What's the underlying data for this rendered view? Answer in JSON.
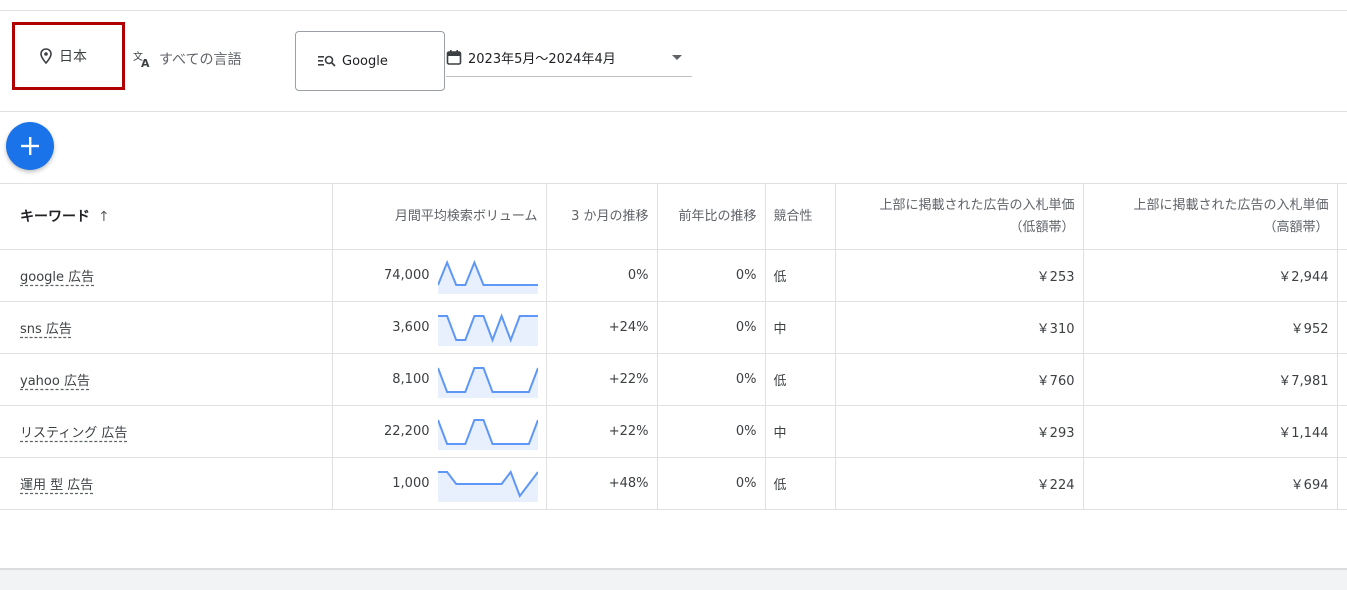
{
  "filters": {
    "location": "日本",
    "language": "すべての言語",
    "network": "Google",
    "date_range": "2023年5月～2024年4月"
  },
  "table": {
    "headers": {
      "keyword": "キーワード",
      "sort_indicator": "↑",
      "avg_monthly": "月間平均検索ボリューム",
      "three_month": "3 か月の推移",
      "yoy": "前年比の推移",
      "competition": "競合性",
      "bid_low_line1": "上部に掲載された広告の入札単価",
      "bid_low_line2": "（低額帯）",
      "bid_high_line1": "上部に掲載された広告の入札単価",
      "bid_high_line2": "（高額帯）"
    },
    "rows": [
      {
        "keyword": "google 広告",
        "volume": "74,000",
        "three_month": "0%",
        "yoy": "0%",
        "competition": "低",
        "bid_low": "￥253",
        "bid_high": "￥2,944",
        "trend": [
          0.2,
          0.95,
          0.2,
          0.2,
          0.95,
          0.2,
          0.2,
          0.2,
          0.2,
          0.2,
          0.2,
          0.2
        ]
      },
      {
        "keyword": "sns 広告",
        "volume": "3,600",
        "three_month": "+24%",
        "yoy": "0%",
        "competition": "中",
        "bid_low": "￥310",
        "bid_high": "￥952",
        "trend": [
          0.9,
          0.9,
          0.1,
          0.1,
          0.9,
          0.9,
          0.1,
          0.9,
          0.1,
          0.9,
          0.9,
          0.9
        ]
      },
      {
        "keyword": "yahoo 広告",
        "volume": "8,100",
        "three_month": "+22%",
        "yoy": "0%",
        "competition": "低",
        "bid_low": "￥760",
        "bid_high": "￥7,981",
        "trend": [
          0.9,
          0.1,
          0.1,
          0.1,
          0.9,
          0.9,
          0.1,
          0.1,
          0.1,
          0.1,
          0.1,
          0.9
        ]
      },
      {
        "keyword": "リスティング 広告",
        "volume": "22,200",
        "three_month": "+22%",
        "yoy": "0%",
        "competition": "中",
        "bid_low": "￥293",
        "bid_high": "￥1,144",
        "trend": [
          0.9,
          0.1,
          0.1,
          0.1,
          0.9,
          0.9,
          0.1,
          0.1,
          0.1,
          0.1,
          0.1,
          0.9
        ]
      },
      {
        "keyword": "運用 型 広告",
        "volume": "1,000",
        "three_month": "+48%",
        "yoy": "0%",
        "competition": "低",
        "bid_low": "￥224",
        "bid_high": "￥694",
        "trend": [
          0.9,
          0.9,
          0.5,
          0.5,
          0.5,
          0.5,
          0.5,
          0.5,
          0.9,
          0.1,
          0.5,
          0.9
        ]
      }
    ]
  },
  "colors": {
    "accent": "#1a73e8",
    "highlight_box": "#b00000",
    "sparkline_line": "#5e97f6",
    "sparkline_fill": "#e8f0fe"
  },
  "icons": {
    "location": "location-pin-icon",
    "language": "translate-icon",
    "network": "search-network-icon",
    "date": "calendar-icon",
    "add": "plus-icon"
  }
}
